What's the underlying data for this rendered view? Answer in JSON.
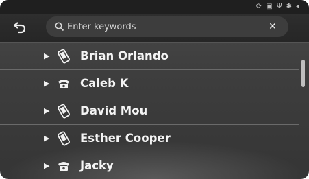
{
  "status_bar": {
    "icons": [
      "sync-icon",
      "sim-icon",
      "usb-icon",
      "bluetooth-icon",
      "volume-icon"
    ]
  },
  "header": {
    "back_icon": "back-arrow-icon",
    "search": {
      "placeholder": "Enter keywords",
      "value": ""
    },
    "clear_icon": "close-icon"
  },
  "contacts": [
    {
      "name": "Brian Orlando",
      "type_icon": "mobile-phone-icon"
    },
    {
      "name": "Caleb K",
      "type_icon": "telephone-icon"
    },
    {
      "name": "David Mou",
      "type_icon": "mobile-phone-icon"
    },
    {
      "name": "Esther Cooper",
      "type_icon": "mobile-phone-icon"
    },
    {
      "name": "Jacky",
      "type_icon": "telephone-icon"
    }
  ],
  "colors": {
    "background": "#3e3e3e",
    "text": "#f4f4f4",
    "divider": "#6a6a6a"
  }
}
